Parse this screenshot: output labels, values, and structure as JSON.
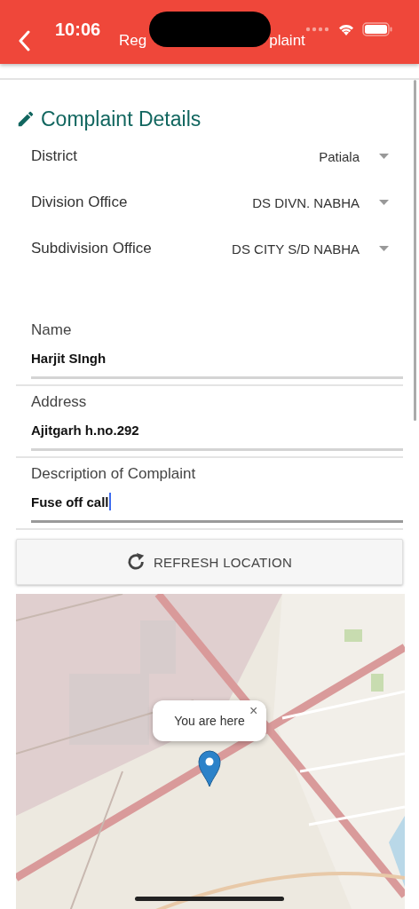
{
  "status_bar": {
    "time": "10:06"
  },
  "header": {
    "title_parts": [
      "Reg",
      "plaint"
    ]
  },
  "section": {
    "title": "Complaint Details"
  },
  "selects": [
    {
      "label": "District",
      "value": "Patiala"
    },
    {
      "label": "Division Office",
      "value": "DS DIVN. NABHA"
    },
    {
      "label": "Subdivision Office",
      "value": "DS CITY S/D NABHA"
    }
  ],
  "fields": [
    {
      "label": "Name",
      "value": "Harjit SIngh",
      "focused": false
    },
    {
      "label": "Address",
      "value": "Ajitgarh h.no.292",
      "focused": false
    },
    {
      "label": "Description of Complaint",
      "value": "Fuse off call",
      "focused": true
    }
  ],
  "refresh_button": {
    "label": "REFRESH LOCATION"
  },
  "map": {
    "kind": "picture",
    "popup": {
      "text": "You are here",
      "close": "×"
    }
  }
}
